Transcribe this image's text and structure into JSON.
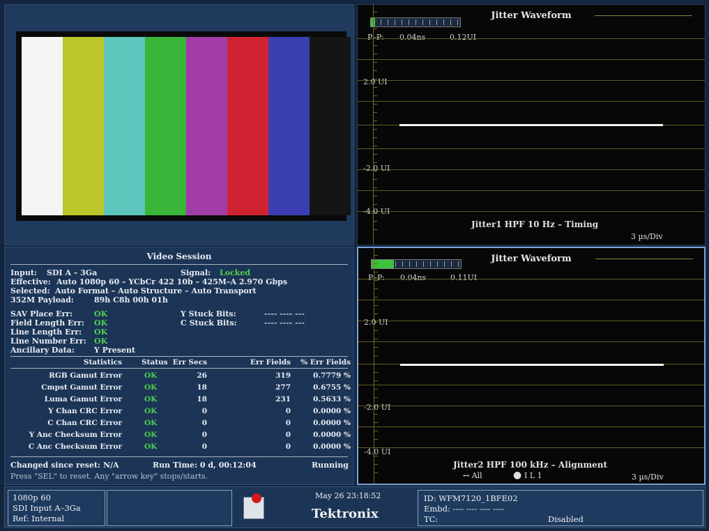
{
  "bars": {
    "colors": [
      "#f4f4f4",
      "#bcc52a",
      "#5dc6bd",
      "#39b53a",
      "#a23ca6",
      "#cf2331",
      "#3b3fb2",
      "#151515"
    ]
  },
  "session": {
    "title": "Video Session",
    "input_label": "Input:",
    "input_value": "SDI A – 3Ga",
    "signal_label": "Signal:",
    "signal_value": "Locked",
    "effective_label": "Effective:",
    "effective_value": "Auto 1080p 60 – YCbCr 422 10b – 425M–A 2.970 Gbps",
    "selected_label": "Selected:",
    "selected_value": "Auto Format – Auto Structure – Auto Transport",
    "payload_label": "352M Payload:",
    "payload_value": "89h C8h 00h 01h",
    "sav_label": "SAV Place Err:",
    "sav_value": "OK",
    "field_label": "Field Length Err:",
    "field_value": "OK",
    "line_len_label": "Line Length Err:",
    "line_len_value": "OK",
    "line_num_label": "Line Number Err:",
    "line_num_value": "OK",
    "anc_label": "Ancillary Data:",
    "anc_value": "Y Present",
    "ystuck_label": "Y Stuck Bits:",
    "ystuck_value": "---- ---- ---",
    "cstuck_label": "C Stuck Bits:",
    "cstuck_value": "---- ---- ---",
    "headers": [
      "Statistics",
      "Status",
      "Err Secs",
      "Err Fields",
      "% Err Fields"
    ],
    "rows": [
      [
        "RGB Gamut Error",
        "OK",
        "26",
        "319",
        "0.7779 %"
      ],
      [
        "Cmpst Gamut Error",
        "OK",
        "18",
        "277",
        "0.6755 %"
      ],
      [
        "Luma Gamut Error",
        "OK",
        "18",
        "231",
        "0.5633 %"
      ],
      [
        "Y Chan CRC Error",
        "OK",
        "0",
        "0",
        "0.0000 %"
      ],
      [
        "C Chan CRC Error",
        "OK",
        "0",
        "0",
        "0.0000 %"
      ],
      [
        "Y Anc Checksum Error",
        "OK",
        "0",
        "0",
        "0.0000 %"
      ],
      [
        "C Anc Checksum Error",
        "OK",
        "0",
        "0",
        "0.0000 %"
      ]
    ],
    "changed": "Changed since reset: N/A",
    "runtime": "Run Time: 0 d, 00:12:04",
    "running": "Running",
    "hint": "Press \"SEL\" to reset.  Any \"arrow key\" stops/starts."
  },
  "wf1": {
    "title": "Jitter Waveform",
    "pp_label": "P–P:",
    "pp_ns": "0.04ns",
    "pp_ui": "0.12UI",
    "meter_fill": 0.05,
    "y_labels": [
      "2.0 UI",
      "-2.0 UI",
      "-4.0 UI"
    ],
    "caption": "Jitter1 HPF 10 Hz – Timing",
    "scale": "3 µs/Div"
  },
  "wf2": {
    "title": "Jitter Waveform",
    "pp_label": "P–P:",
    "pp_ns": "0.04ns",
    "pp_ui": "0.11UI",
    "meter_fill": 0.25,
    "y_labels": [
      "2.0 UI",
      "-2.0 UI",
      "-4.0 UI"
    ],
    "caption": "Jitter2 HPF 100 kHz – Alignment",
    "all_label": "↔ All",
    "icons_label": "I L 1",
    "scale": "3 µs/Div"
  },
  "status": {
    "format": "1080p 60",
    "input": "SDI Input A–3Ga",
    "ref": "Ref: Internal",
    "datetime": "May 26 23:18:52",
    "brand": "Tektronix",
    "id": "ID: WFM7120_1BFE02",
    "embd": "Embd: ---- ---- ---- ----",
    "tc_label": "TC:",
    "tc_value": "Disabled"
  }
}
